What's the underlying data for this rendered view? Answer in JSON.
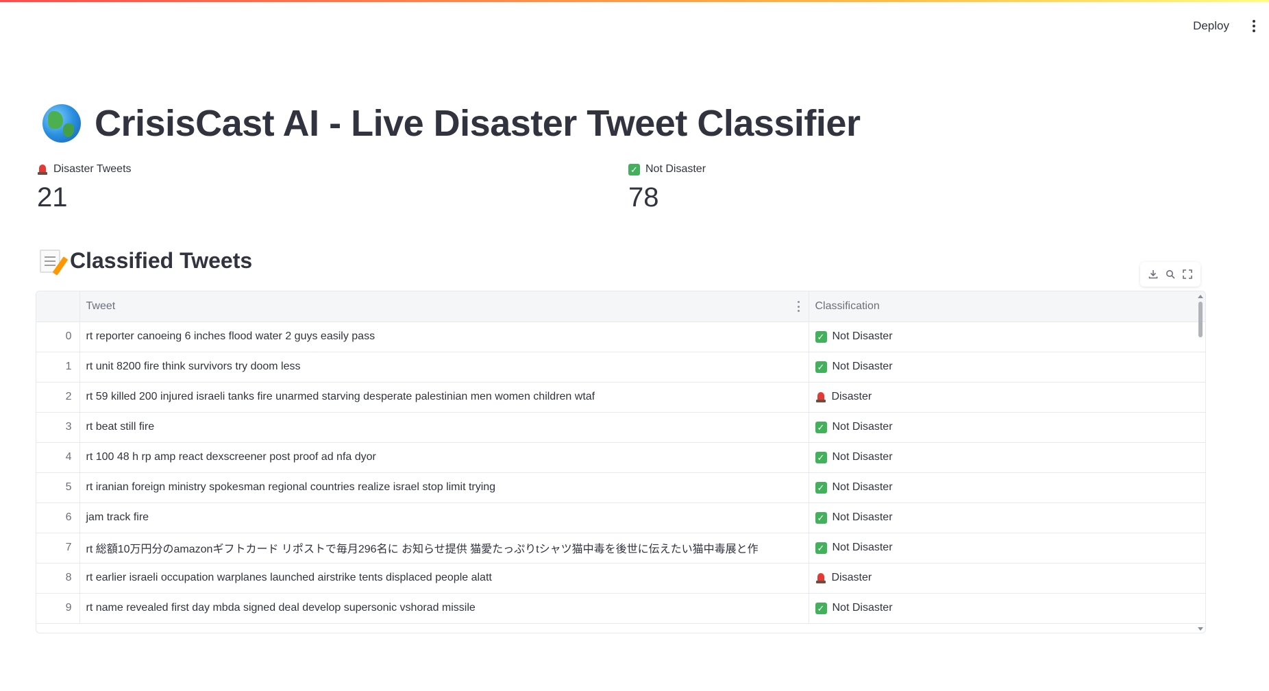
{
  "header": {
    "deploy_label": "Deploy",
    "menu_icon": "kebab-menu-icon"
  },
  "title": {
    "icon": "globe-icon",
    "text": "CrisisCast AI - Live Disaster Tweet Classifier"
  },
  "metrics": [
    {
      "icon": "siren-icon",
      "label": "Disaster Tweets",
      "value": "21"
    },
    {
      "icon": "check-icon",
      "label": "Not Disaster",
      "value": "78"
    }
  ],
  "subheader": {
    "icon": "memo-icon",
    "text": "Classified Tweets"
  },
  "dataframe_toolbar": {
    "download_icon": "download-icon",
    "search_icon": "search-icon",
    "fullscreen_icon": "fullscreen-icon"
  },
  "table": {
    "columns": [
      "",
      "Tweet",
      "Classification"
    ],
    "rows": [
      {
        "idx": "0",
        "tweet": "rt reporter canoeing 6 inches flood water 2 guys easily pass",
        "icon": "check-icon",
        "cls": "Not Disaster"
      },
      {
        "idx": "1",
        "tweet": "rt unit 8200 fire think survivors try doom less",
        "icon": "check-icon",
        "cls": "Not Disaster"
      },
      {
        "idx": "2",
        "tweet": "rt 59 killed 200 injured israeli tanks fire unarmed starving desperate palestinian men women children wtaf",
        "icon": "siren-icon",
        "cls": "Disaster"
      },
      {
        "idx": "3",
        "tweet": "rt beat still fire",
        "icon": "check-icon",
        "cls": "Not Disaster"
      },
      {
        "idx": "4",
        "tweet": "rt 100 48 h rp amp react dexscreener post proof ad nfa dyor",
        "icon": "check-icon",
        "cls": "Not Disaster"
      },
      {
        "idx": "5",
        "tweet": "rt iranian foreign ministry spokesman regional countries realize israel stop limit trying",
        "icon": "check-icon",
        "cls": "Not Disaster"
      },
      {
        "idx": "6",
        "tweet": "jam track fire",
        "icon": "check-icon",
        "cls": "Not Disaster"
      },
      {
        "idx": "7",
        "tweet": "rt 総額10万円分のamazonギフトカード リポストで毎月296名に お知らせ提供 猫愛たっぷりtシャツ猫中毒を後世に伝えたい猫中毒展と作",
        "icon": "check-icon",
        "cls": "Not Disaster"
      },
      {
        "idx": "8",
        "tweet": "rt earlier israeli occupation warplanes launched airstrike tents displaced people alatt",
        "icon": "siren-icon",
        "cls": "Disaster"
      },
      {
        "idx": "9",
        "tweet": "rt name revealed first day mbda signed deal develop supersonic vshorad missile",
        "icon": "check-icon",
        "cls": "Not Disaster"
      }
    ]
  }
}
